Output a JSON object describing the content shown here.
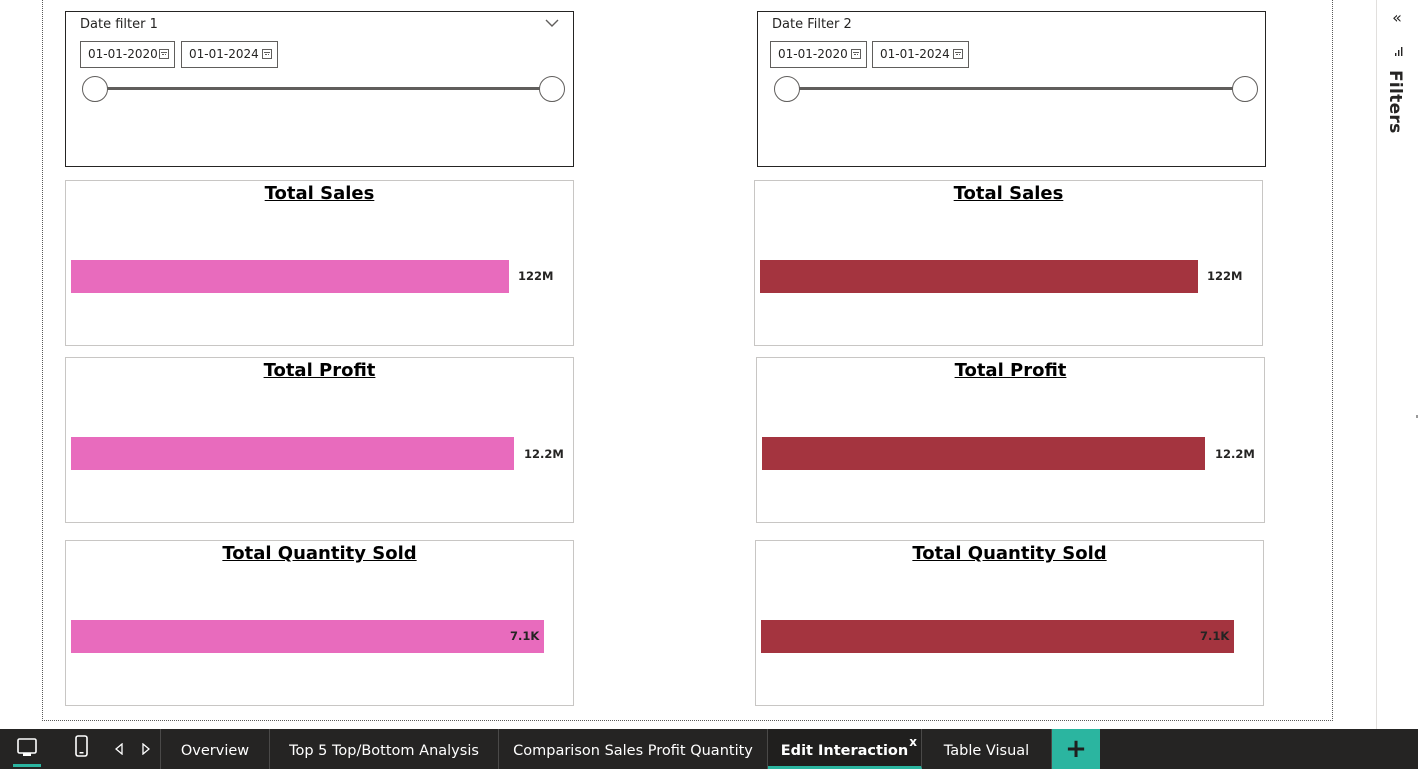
{
  "filters_pane": {
    "label": "Filters",
    "collapse_glyph": "«",
    "icon": "filter-icon"
  },
  "slicers": [
    {
      "title": "Date filter 1",
      "start": "01-01-2020",
      "end": "01-01-2024",
      "has_chevron": true
    },
    {
      "title": "Date Filter 2",
      "start": "01-01-2020",
      "end": "01-01-2024",
      "has_chevron": false
    }
  ],
  "cards": {
    "left": [
      {
        "title": "Total Sales",
        "label": "122M",
        "value_fraction": 0.88
      },
      {
        "title": "Total Profit",
        "label": "12.2M",
        "value_fraction": 0.89
      },
      {
        "title": "Total Quantity Sold",
        "label": "7.1K",
        "value_fraction": 0.95
      }
    ],
    "right": [
      {
        "title": "Total Sales",
        "label": "122M",
        "value_fraction": 0.88
      },
      {
        "title": "Total Profit",
        "label": "12.2M",
        "value_fraction": 0.89
      },
      {
        "title": "Total Quantity Sold",
        "label": "7.1K",
        "value_fraction": 0.95
      }
    ]
  },
  "colors": {
    "left_bar": "#e86bbd",
    "right_bar": "#a4343f",
    "tab_accent": "#2bb5a0",
    "tabbar_bg": "#252423"
  },
  "tabs": [
    {
      "label": "Overview",
      "active": false
    },
    {
      "label": "Top 5 Top/Bottom Analysis",
      "active": false
    },
    {
      "label": "Comparison Sales Profit Quantity",
      "active": false
    },
    {
      "label": "Edit Interaction",
      "active": true,
      "close": "x"
    },
    {
      "label": "Table Visual",
      "active": false
    }
  ],
  "add_tab_glyph": "+"
}
